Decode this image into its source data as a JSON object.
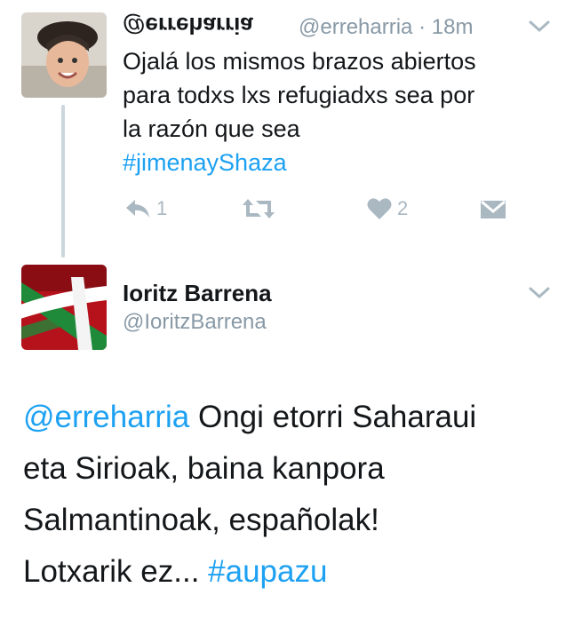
{
  "tweet1": {
    "display_name": "@erreharria",
    "handle": "@erreharria",
    "time": "18m",
    "text_lines": [
      "Ojalá los mismos brazos abiertos",
      "para todxs lxs refugiadxs sea por",
      "la razón que sea"
    ],
    "hashtag": "#jimenayShaza",
    "reply_count": "1",
    "like_count": "2"
  },
  "tweet2": {
    "display_name": "Ioritz Barrena",
    "handle": "@IoritzBarrena",
    "mention": "@erreharria",
    "line1_rest": " Ongi etorri Saharaui",
    "line2": "eta Sirioak, baina kanpora",
    "line3": "Salmantinoak, españolak!",
    "line4_text": "Lotxarik ez... ",
    "hashtag": "#aupazu"
  },
  "colors": {
    "link": "#1da1f2",
    "muted": "#8899a6",
    "icon": "#aab8c2"
  },
  "icons": [
    "reply-icon",
    "retweet-icon",
    "heart-icon",
    "dm-icon",
    "chevron-down-icon"
  ]
}
